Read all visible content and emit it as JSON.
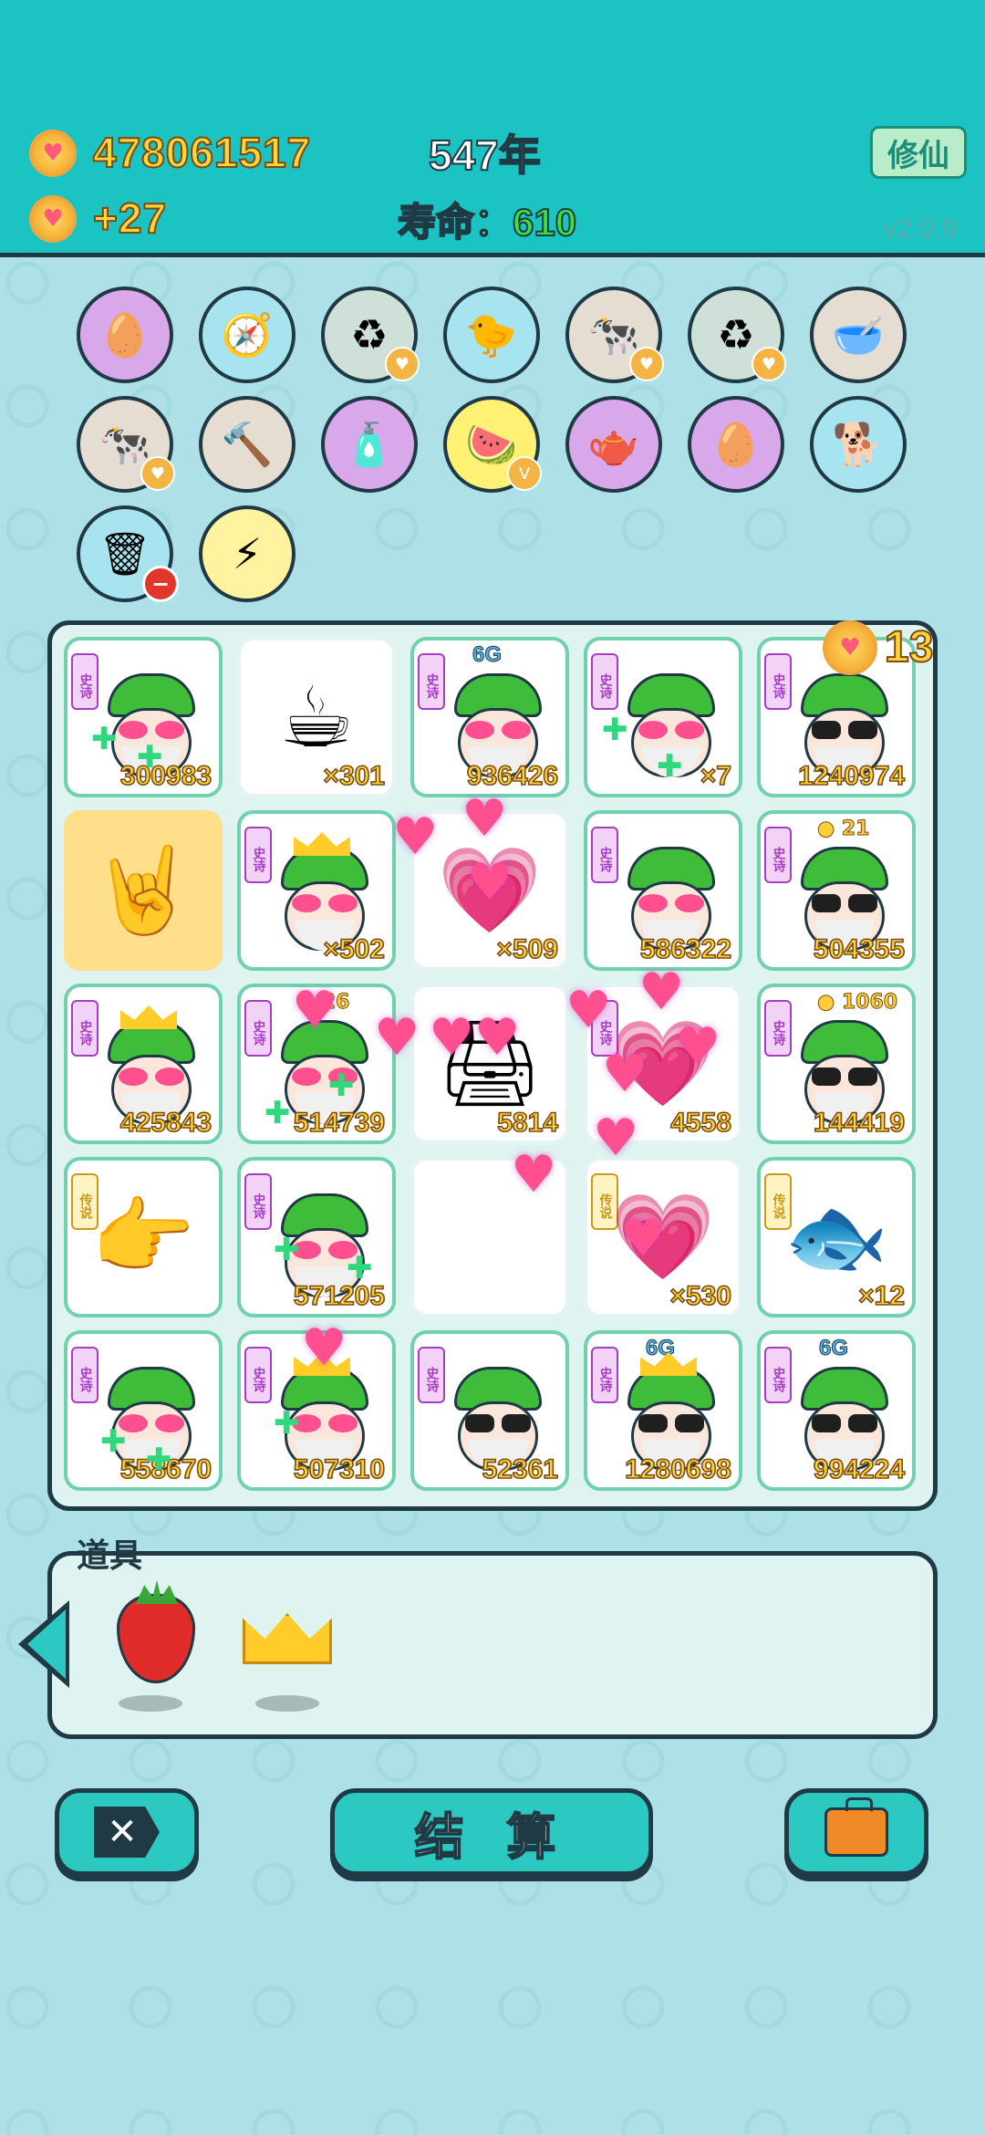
{
  "header": {
    "coins": "478061517",
    "income": "+27",
    "year": "547年",
    "lifespan_label": "寿命：",
    "lifespan_value": "610",
    "cultivate_button": "修仙",
    "version": "v2.0.9"
  },
  "skills": [
    {
      "icon": "egg-icon",
      "bg": "#d9a8ea"
    },
    {
      "icon": "compass-icon",
      "bg": "#a8e3f0"
    },
    {
      "icon": "refresh-icon",
      "bg": "#cfe0d9",
      "badge": true
    },
    {
      "icon": "chick-icon",
      "bg": "#a8e3f0"
    },
    {
      "icon": "cows-icon",
      "bg": "#e6ddd2",
      "badge": true
    },
    {
      "icon": "refresh-icon",
      "bg": "#cfe0d9",
      "badge": true
    },
    {
      "icon": "dog-bowl-icon",
      "bg": "#e6ddd2"
    },
    {
      "icon": "cows-icon",
      "bg": "#e6ddd2",
      "badge": true
    },
    {
      "icon": "hammer-icon",
      "bg": "#e6ddd2"
    },
    {
      "icon": "spray-bottle-icon",
      "bg": "#d9a8ea"
    },
    {
      "icon": "fruit-basket-icon",
      "bg": "#fff174",
      "badge": "V"
    },
    {
      "icon": "gravy-boat-icon",
      "bg": "#d9a8ea"
    },
    {
      "icon": "egg-icon",
      "bg": "#d9a8ea"
    },
    {
      "icon": "dog-sunglasses-icon",
      "bg": "#a8e3f0"
    },
    {
      "icon": "trash-bag-icon",
      "bg": "#a8e3f0",
      "minus": true
    },
    {
      "icon": "lightning-icon",
      "bg": "#fff3a0"
    }
  ],
  "board": {
    "coin_count": "13",
    "tag_epic": "史诗",
    "tag_legend": "传说",
    "cells": [
      {
        "kind": "face",
        "tag": "epic",
        "eyes": "love",
        "num": "300983"
      },
      {
        "kind": "coffee",
        "num": "×301"
      },
      {
        "kind": "face",
        "tag": "epic",
        "eyes": "love",
        "num": "936426",
        "g6": "6G"
      },
      {
        "kind": "face",
        "tag": "epic",
        "eyes": "love",
        "num": "×7"
      },
      {
        "kind": "face",
        "tag": "epic",
        "eyes": "glasses",
        "num": "1240974"
      },
      {
        "kind": "hand-up",
        "yellow": true
      },
      {
        "kind": "face",
        "tag": "epic",
        "eyes": "love",
        "crown": true,
        "num": "×502"
      },
      {
        "kind": "hearts",
        "num": "×509"
      },
      {
        "kind": "face",
        "tag": "epic",
        "eyes": "love",
        "num": "586322"
      },
      {
        "kind": "face",
        "tag": "epic",
        "eyes": "glasses",
        "num": "504355",
        "coin_small": "21"
      },
      {
        "kind": "face",
        "tag": "epic",
        "eyes": "love",
        "crown": true,
        "num": "425843"
      },
      {
        "kind": "face",
        "tag": "epic",
        "eyes": "love",
        "num": "514739",
        "coin_small": "26"
      },
      {
        "kind": "printer",
        "num": "5814"
      },
      {
        "kind": "hearts",
        "tag": "epic",
        "num": "4558"
      },
      {
        "kind": "face",
        "tag": "epic",
        "eyes": "glasses",
        "num": "144419",
        "coin_small": "1060"
      },
      {
        "kind": "hand-point",
        "tag": "legend"
      },
      {
        "kind": "face",
        "tag": "epic",
        "eyes": "love",
        "num": "571205"
      },
      {
        "kind": "empty"
      },
      {
        "kind": "hearts",
        "tag": "legend",
        "num": "×530"
      },
      {
        "kind": "fish",
        "tag": "legend",
        "num": "×12"
      },
      {
        "kind": "face",
        "tag": "epic",
        "eyes": "love",
        "num": "558670"
      },
      {
        "kind": "face",
        "tag": "epic",
        "eyes": "love",
        "crown": true,
        "num": "507310"
      },
      {
        "kind": "face",
        "tag": "epic",
        "eyes": "glasses",
        "num": "52361"
      },
      {
        "kind": "face",
        "tag": "epic",
        "eyes": "glasses",
        "crown": true,
        "num": "1280698",
        "g6": "6G"
      },
      {
        "kind": "face",
        "tag": "epic",
        "eyes": "glasses",
        "num": "994224",
        "g6": "6G"
      }
    ]
  },
  "items": {
    "label": "道具",
    "list": [
      {
        "icon": "strawberry-icon"
      },
      {
        "icon": "crown-icon"
      }
    ]
  },
  "buttons": {
    "settle": "结 算"
  },
  "colors": {
    "header_bg": "#1bc3c3",
    "coin_text": "#ffd53a",
    "lifespan": "#3ce23c",
    "button_bg": "#2bc9c2"
  }
}
